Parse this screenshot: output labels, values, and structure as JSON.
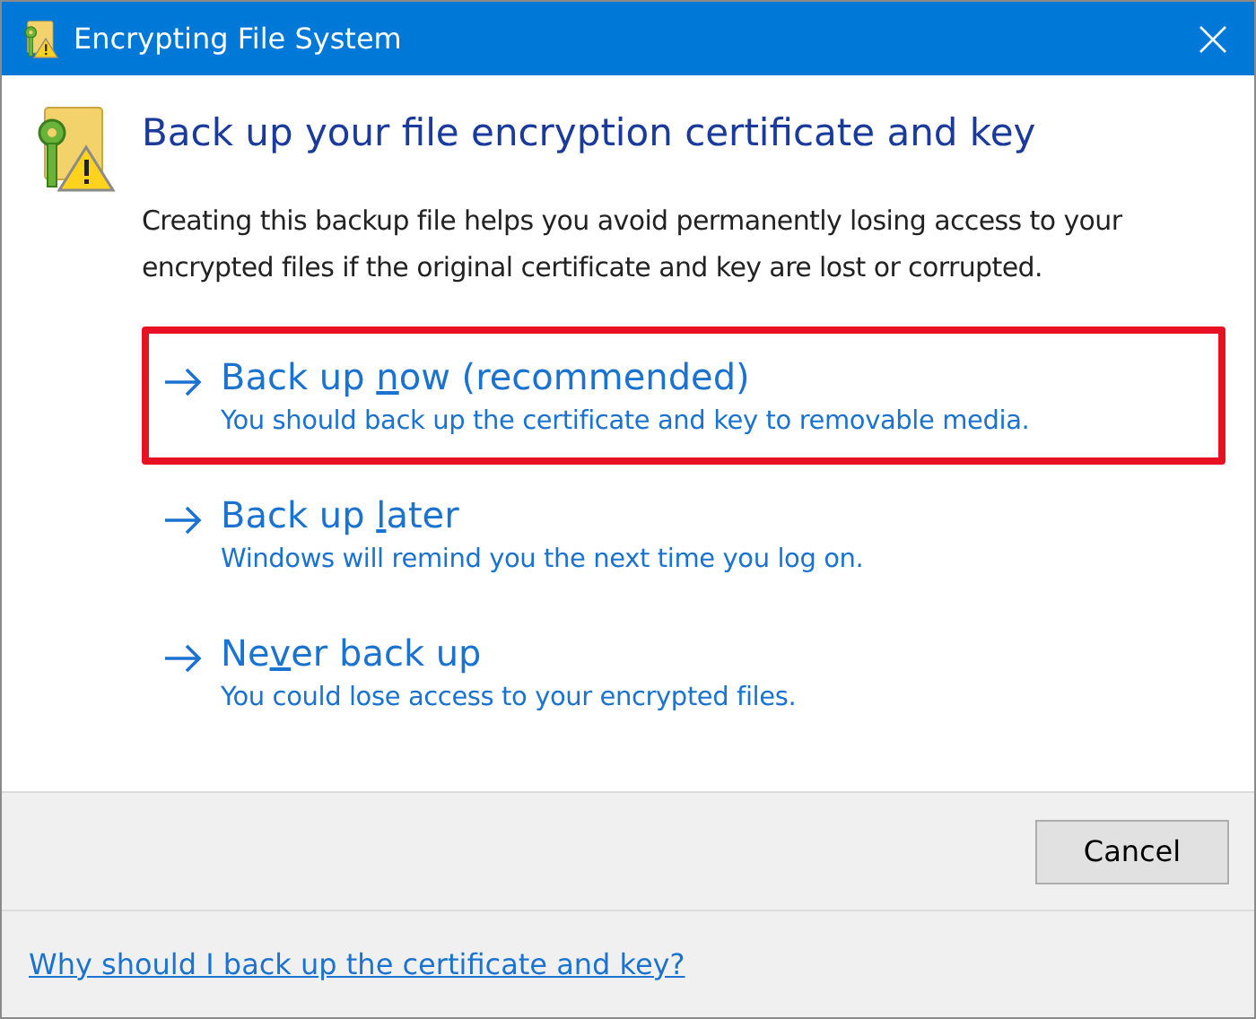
{
  "window": {
    "title": "Encrypting File System"
  },
  "heading": "Back up your file encryption certificate and key",
  "description": "Creating this backup file helps you avoid permanently losing access to your encrypted files if the original certificate and key are lost or corrupted.",
  "options": [
    {
      "title": {
        "before": "Back up ",
        "key": "n",
        "after": "ow (recommended)"
      },
      "subtitle": "You should back up the certificate and key to removable media.",
      "highlighted": true
    },
    {
      "title": {
        "before": "Back up ",
        "key": "l",
        "after": "ater"
      },
      "subtitle": "Windows will remind you the next time you log on.",
      "highlighted": false
    },
    {
      "title": {
        "before": "Ne",
        "key": "v",
        "after": "er back up"
      },
      "subtitle": "You could lose access to your encrypted files.",
      "highlighted": false
    }
  ],
  "buttons": [
    "Cancel"
  ],
  "help_link": "Why should I back up the certificate and key?"
}
